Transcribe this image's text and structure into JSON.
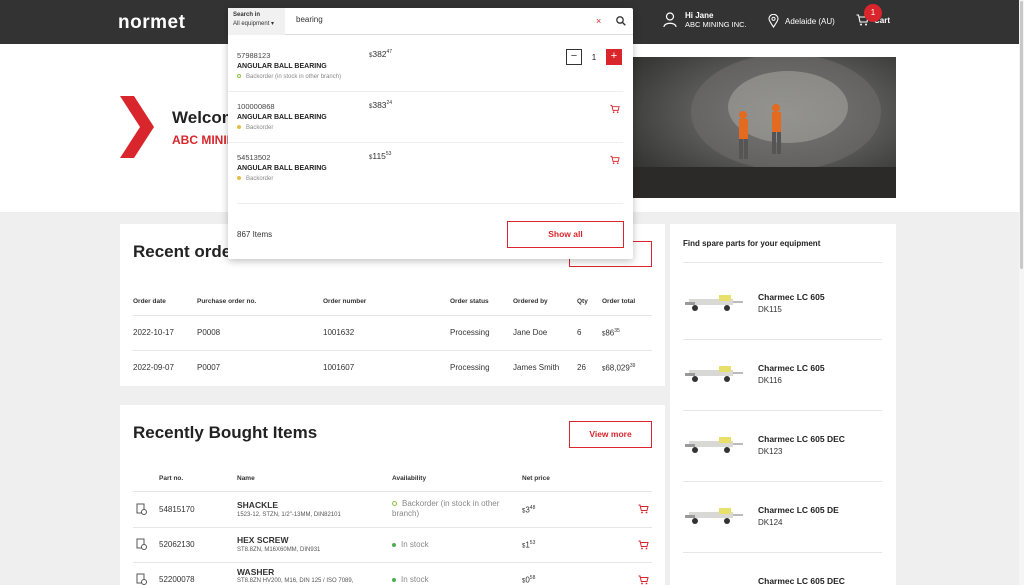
{
  "header": {
    "logo": "normet",
    "greeting": "Hi Jane",
    "company": "ABC MINING INC.",
    "location": "Adelaide (AU)",
    "cart_label": "Cart",
    "cart_count": "1"
  },
  "search": {
    "scope_label": "Search in",
    "scope_value": "All equipment",
    "query": "bearing",
    "clear": "×",
    "results": [
      {
        "part_no": "57988123",
        "name": "ANGULAR BALL BEARING",
        "status": "Backorder (in stock in other branch)",
        "price_cur": "$",
        "price_int": "382",
        "price_dec": "47",
        "qty": "1"
      },
      {
        "part_no": "100000868",
        "name": "ANGULAR BALL BEARING",
        "status": "Backorder",
        "price_cur": "$",
        "price_int": "383",
        "price_dec": "24"
      },
      {
        "part_no": "54513502",
        "name": "ANGULAR BALL BEARING",
        "status": "Backorder",
        "price_cur": "$",
        "price_int": "115",
        "price_dec": "53"
      }
    ],
    "count": "867 Items",
    "show_all": "Show all"
  },
  "hero": {
    "welcome": "Welcome",
    "company": "ABC MINING INC."
  },
  "recent_orders": {
    "title": "Recent orders",
    "columns": [
      "Order date",
      "Purchase order no.",
      "Order number",
      "Order status",
      "Ordered by",
      "Qty",
      "Order total"
    ],
    "rows": [
      {
        "date": "2022-10-17",
        "po": "P0008",
        "order": "1001632",
        "status": "Processing",
        "by": "Jane Doe",
        "qty": "6",
        "cur": "$",
        "int": "86",
        "dec": "35"
      },
      {
        "date": "2022-09-07",
        "po": "P0007",
        "order": "1001607",
        "status": "Processing",
        "by": "James Smith",
        "qty": "26",
        "cur": "$",
        "int": "68,029",
        "dec": "39"
      }
    ]
  },
  "recent_items": {
    "title": "Recently Bought Items",
    "view_more": "View more",
    "columns": [
      "Part no.",
      "Name",
      "Availability",
      "Net price"
    ],
    "rows": [
      {
        "part": "54815170",
        "name": "SHACKLE",
        "desc": "1523-12, STZN, 1/2\"-13MM, DIN82101",
        "avail": "Backorder (in stock in other branch)",
        "cur": "$",
        "int": "3",
        "dec": "48"
      },
      {
        "part": "52062130",
        "name": "HEX SCREW",
        "desc": "ST8.8ZN, M16X60MM, DIN931",
        "avail": "In stock",
        "cur": "$",
        "int": "1",
        "dec": "53"
      },
      {
        "part": "52200078",
        "name": "WASHER",
        "desc": "ST8.8ZN HV200, M16, DIN 125 / ISO 7089,",
        "avail": "In stock",
        "cur": "$",
        "int": "0",
        "dec": "58"
      }
    ]
  },
  "spare_parts": {
    "title": "Find spare parts for your equipment",
    "items": [
      {
        "name": "Charmec LC 605",
        "code": "DK115"
      },
      {
        "name": "Charmec LC 605",
        "code": "DK116"
      },
      {
        "name": "Charmec LC 605 DEC",
        "code": "DK123"
      },
      {
        "name": "Charmec LC 605 DE",
        "code": "DK124"
      },
      {
        "name": "Charmec LC 605 DEC",
        "code": ""
      }
    ]
  },
  "colors": {
    "brand_red": "#d9262c",
    "header_bg": "#333333"
  }
}
